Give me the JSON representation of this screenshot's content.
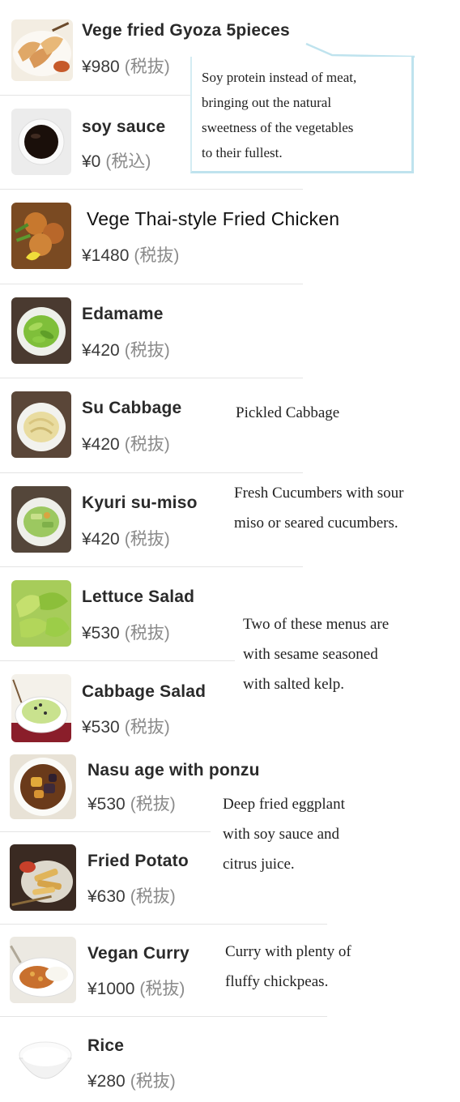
{
  "items": [
    {
      "name": "Vege fried Gyoza 5pieces",
      "price": "¥980",
      "tax": "(税抜)",
      "icon": "gyoza-icon"
    },
    {
      "name": "soy sauce",
      "price": "¥0",
      "tax": "(税込)",
      "icon": "soy-sauce-icon"
    },
    {
      "name": "Vege Thai-style Fried Chicken",
      "price": "¥1480",
      "tax": "(税抜)",
      "icon": "fried-chicken-icon"
    },
    {
      "name": "Edamame",
      "price": "¥420",
      "tax": "(税抜)",
      "icon": "edamame-icon"
    },
    {
      "name": "Su Cabbage",
      "price": "¥420",
      "tax": "(税抜)",
      "icon": "cabbage-icon"
    },
    {
      "name": "Kyuri su-miso",
      "price": "¥420",
      "tax": "(税抜)",
      "icon": "cucumber-icon"
    },
    {
      "name": "Lettuce Salad",
      "price": "¥530",
      "tax": "(税抜)",
      "icon": "lettuce-icon"
    },
    {
      "name": "Cabbage Salad",
      "price": "¥530",
      "tax": "(税抜)",
      "icon": "salad-icon"
    },
    {
      "name": "Nasu age with ponzu",
      "price": "¥530",
      "tax": "(税抜)",
      "icon": "eggplant-icon"
    },
    {
      "name": "Fried  Potato",
      "price": "¥630",
      "tax": "(税抜)",
      "icon": "fries-icon"
    },
    {
      "name": "Vegan Curry",
      "price": "¥1000",
      "tax": "(税抜)",
      "icon": "curry-icon"
    },
    {
      "name": "Rice",
      "price": "¥280",
      "tax": "(税抜)",
      "icon": "rice-bowl-icon"
    }
  ],
  "callout": {
    "lines": [
      "Soy protein instead of meat,",
      "bringing out the natural",
      "sweetness of the vegetables",
      "to their fullest."
    ]
  },
  "notes": {
    "su_cabbage": [
      "Pickled Cabbage"
    ],
    "kyuri": [
      "Fresh Cucumbers with sour",
      "miso or seared cucumbers."
    ],
    "salads": [
      "Two of these menus are",
      "with sesame seasoned",
      "with salted kelp."
    ],
    "nasu": [
      "Deep fried eggplant",
      "with soy sauce and",
      "citrus juice."
    ],
    "curry": [
      "Curry with plenty of",
      "fluffy chickpeas."
    ]
  },
  "colors": {
    "accent_border": "#bfe3ee",
    "tax_text": "#8a8a8a",
    "separator": "#e4e4e4"
  }
}
